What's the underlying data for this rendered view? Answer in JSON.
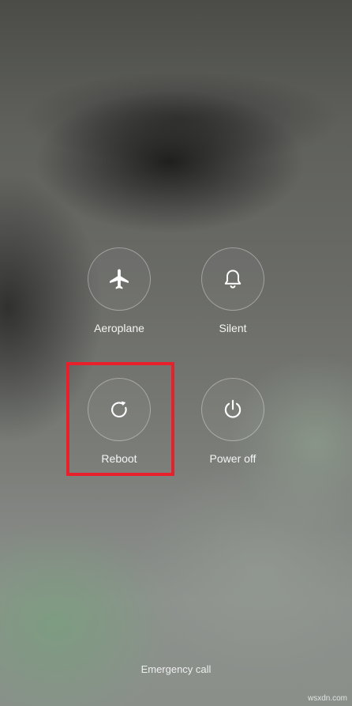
{
  "power_menu": {
    "items": [
      {
        "label": "Aeroplane",
        "icon": "airplane-icon"
      },
      {
        "label": "Silent",
        "icon": "bell-icon"
      },
      {
        "label": "Reboot",
        "icon": "reboot-icon",
        "highlighted": true
      },
      {
        "label": "Power off",
        "icon": "power-icon"
      }
    ],
    "highlight_color": "#e8202c"
  },
  "emergency_call": "Emergency call",
  "watermark": "wsxdn.com"
}
